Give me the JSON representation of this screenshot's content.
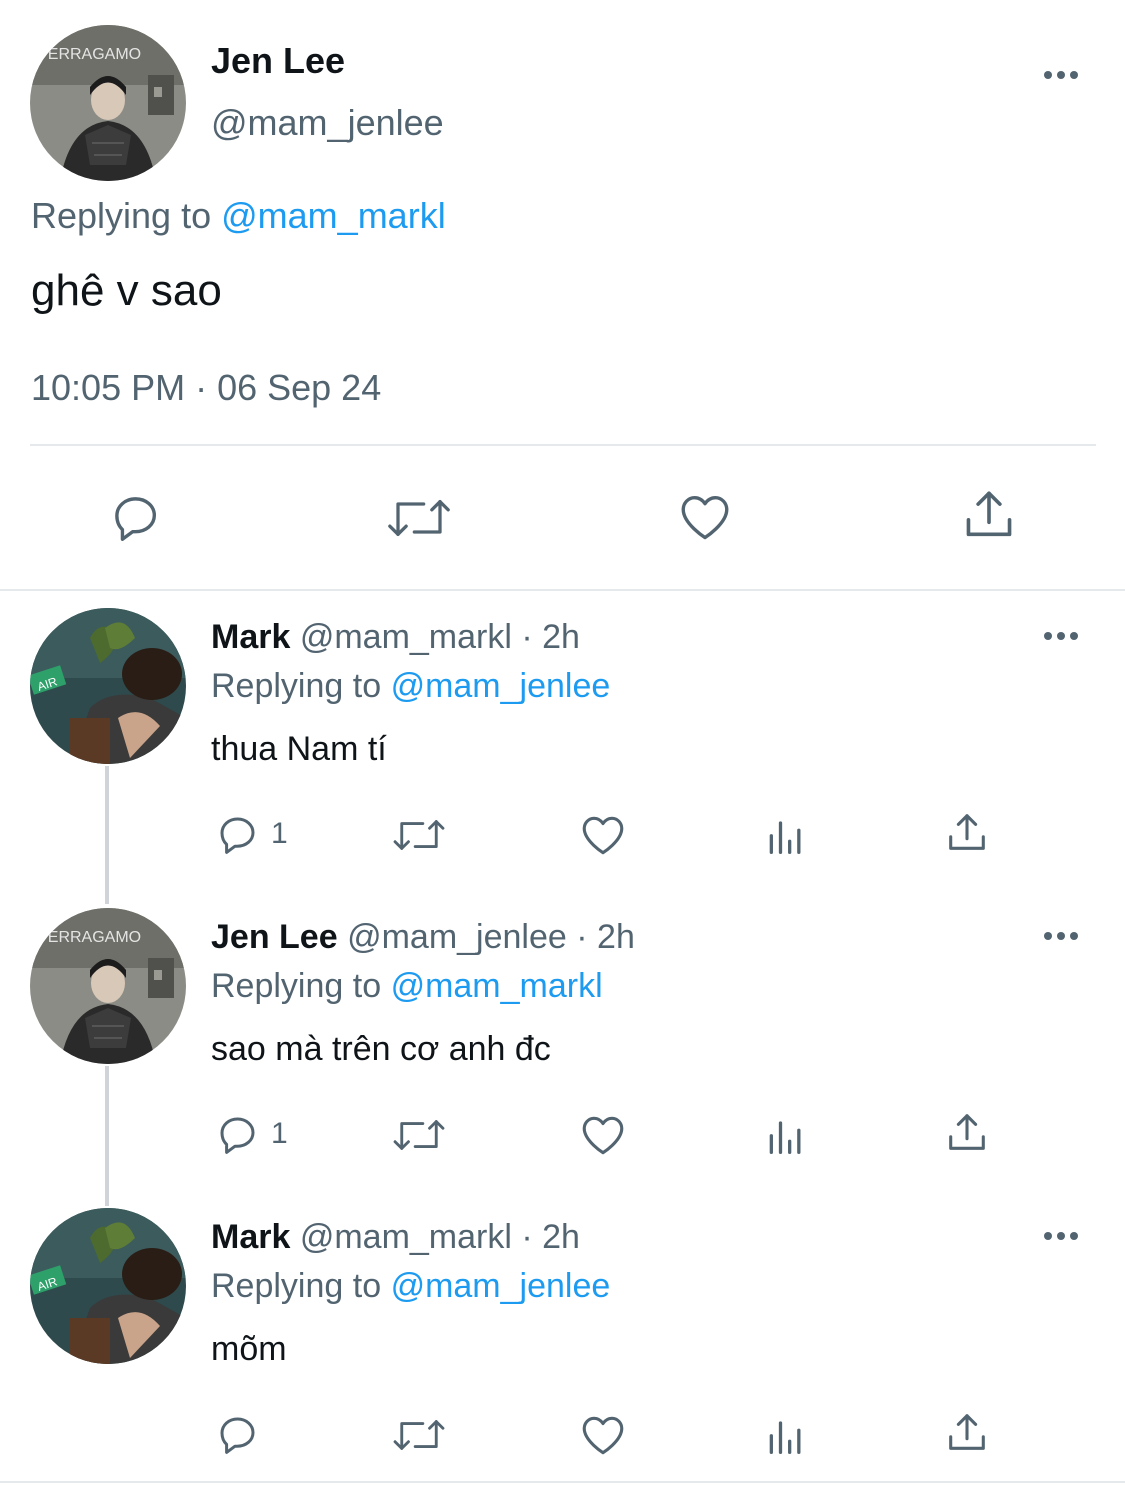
{
  "main_tweet": {
    "name": "Jen Lee",
    "handle": "@mam_jenlee",
    "replying_prefix": "Replying to",
    "replying_to": "@mam_markl",
    "text": "ghê v sao",
    "timestamp": "10:05 PM · 06 Sep 24",
    "avatar_text": "FERRAGAMO",
    "actions": [
      "reply-icon",
      "retweet-icon",
      "like-icon",
      "share-icon"
    ]
  },
  "replies": [
    {
      "name": "Mark",
      "handle": "@mam_markl",
      "time": "· 2h",
      "replying_prefix": "Replying to",
      "replying_to": "@mam_jenlee",
      "text": "thua Nam tí",
      "reply_count": "1",
      "avatar_text": "AIR"
    },
    {
      "name": "Jen Lee",
      "handle": "@mam_jenlee",
      "time": "· 2h",
      "replying_prefix": "Replying to",
      "replying_to": "@mam_markl",
      "text": "sao mà trên cơ anh đc",
      "reply_count": "1",
      "avatar_text": "FERRAGAMO"
    },
    {
      "name": "Mark",
      "handle": "@mam_markl",
      "time": "· 2h",
      "replying_prefix": "Replying to",
      "replying_to": "@mam_jenlee",
      "text": "mõm",
      "reply_count": "",
      "avatar_text": "AIR"
    }
  ],
  "colors": {
    "accent": "#1d9bf0",
    "text": "#0f1419",
    "secondary": "#536471",
    "divider": "#e6e9eb"
  }
}
